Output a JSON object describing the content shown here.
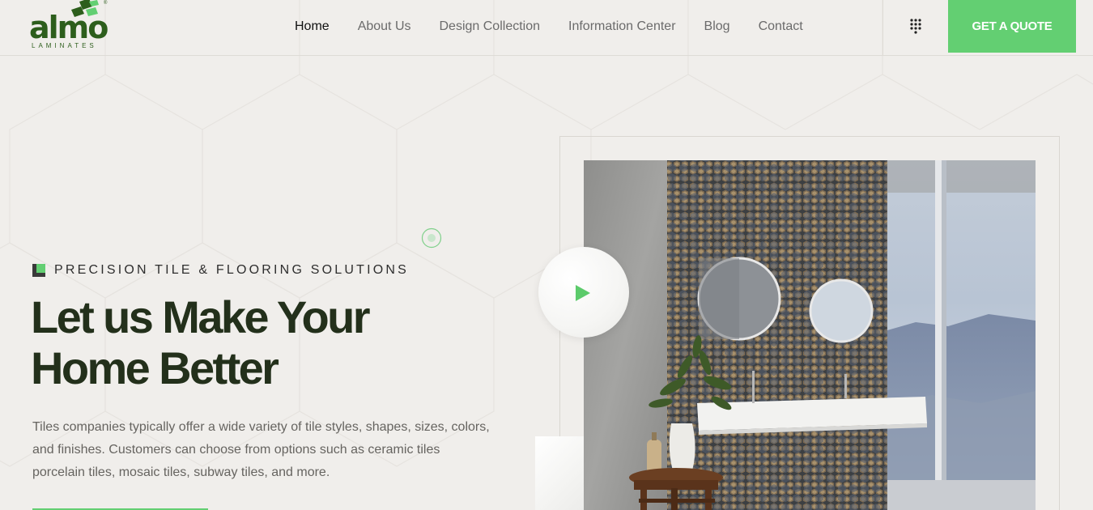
{
  "brand": {
    "logo_text": "almo",
    "logo_subtext": "LAMINATES",
    "registered_mark": "®",
    "primary_color": "#2d5e1c",
    "accent_color": "#63cf72"
  },
  "nav": {
    "items": [
      {
        "label": "Home",
        "active": true
      },
      {
        "label": "About Us",
        "active": false
      },
      {
        "label": "Design Collection",
        "active": false
      },
      {
        "label": "Information Center",
        "active": false
      },
      {
        "label": "Blog",
        "active": false
      },
      {
        "label": "Contact",
        "active": false
      }
    ]
  },
  "header": {
    "menu_icon": "dots-grid-icon",
    "quote_label": "GET A QUOTE"
  },
  "hero": {
    "eyebrow": "PRECISION TILE & FLOORING SOLUTIONS",
    "title_line1": "Let us Make Your",
    "title_line2": "Home Better",
    "description": "Tiles companies typically offer a wide variety of tile styles, shapes, sizes, colors, and finishes. Customers can choose from options such as ceramic tiles porcelain tiles, mosaic tiles, subway tiles, and more.",
    "play_icon": "play-icon"
  }
}
